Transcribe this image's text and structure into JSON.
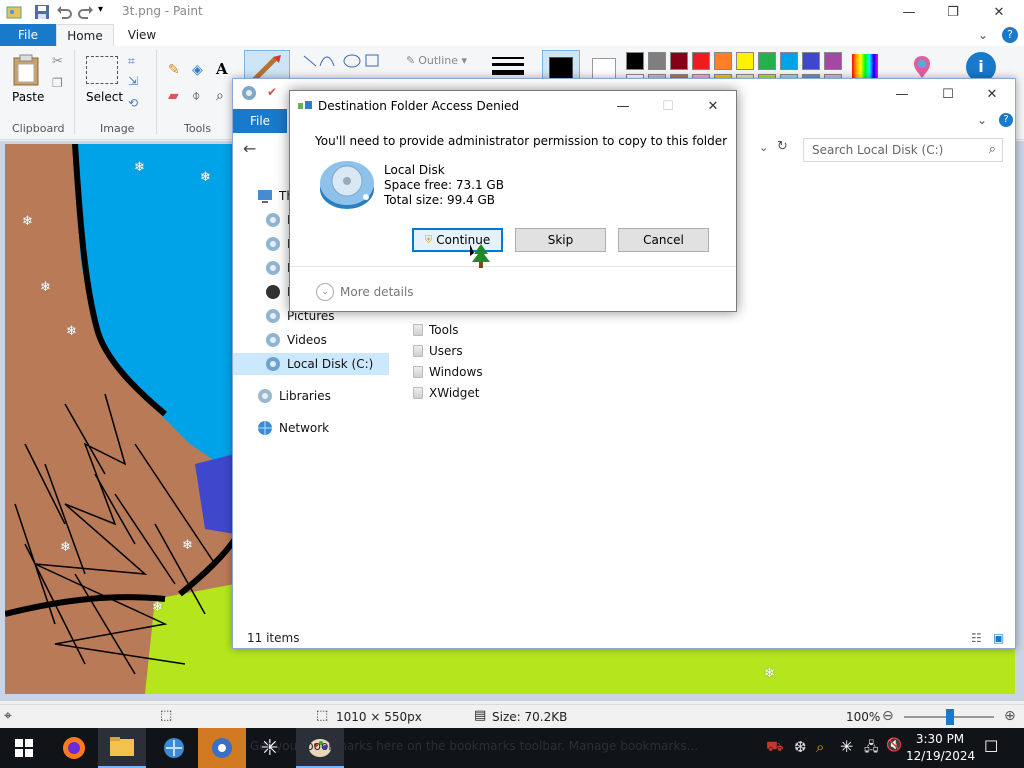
{
  "paint": {
    "title": "3t.png - Paint",
    "tabs": {
      "file": "File",
      "home": "Home",
      "view": "View"
    },
    "groups": {
      "clipboard": "Clipboard",
      "image": "Image",
      "tools": "Tools",
      "paste": "Paste",
      "select": "Select",
      "outline": "Outline"
    },
    "palette": [
      "#000000",
      "#7f7f7f",
      "#880015",
      "#ed1c24",
      "#ff7f27",
      "#fff200",
      "#22b14c",
      "#00a2e8",
      "#3f48cc",
      "#a349a4",
      "#ffffff",
      "#c3c3c3",
      "#b97a57",
      "#ffaec9",
      "#ffc90e",
      "#efe4b0",
      "#b5e61d",
      "#99d9ea",
      "#7092be",
      "#c8bfe7"
    ],
    "status": {
      "dimensions": "1010 × 550px",
      "size": "Size: 70.2KB",
      "zoom": "100%"
    }
  },
  "explorer": {
    "file_tab": "File",
    "search_placeholder": "Search Local Disk (C:)",
    "nav": {
      "this_pc": "Th",
      "pictures": "Pictures",
      "videos": "Videos",
      "local_disk": "Local Disk (C:)",
      "libraries": "Libraries",
      "network": "Network"
    },
    "files": [
      "Tools",
      "Users",
      "Windows",
      "XWidget"
    ],
    "status": "11 items"
  },
  "dialog": {
    "title": "Destination Folder Access Denied",
    "message": "You'll need to provide administrator permission to copy to this folder",
    "drive_name": "Local Disk",
    "space_free": "Space free: 73.1 GB",
    "total_size": "Total size: 99.4 GB",
    "buttons": {
      "continue": "Continue",
      "skip": "Skip",
      "cancel": "Cancel"
    },
    "more_details": "More details"
  },
  "taskbar": {
    "hint": "Get your bookmarks here on the bookmarks toolbar. Manage bookmarks...",
    "time": "3:30 PM",
    "date": "12/19/2024"
  }
}
